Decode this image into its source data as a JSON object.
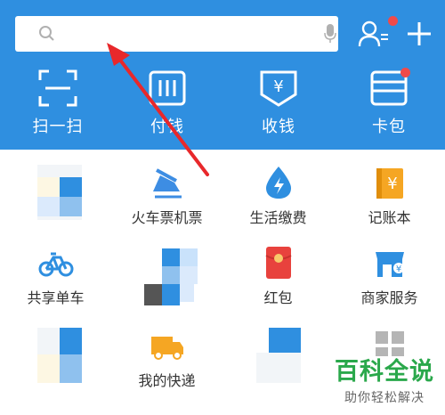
{
  "colors": {
    "brand": "#2f8fe0",
    "badge": "#f04a4a",
    "arrow": "#e8282b",
    "watermark": "#2aa84b"
  },
  "header": {
    "search": {
      "placeholder": "",
      "value": ""
    },
    "icons": [
      "contacts-icon",
      "add-icon"
    ]
  },
  "quick_actions": [
    {
      "label": "扫一扫",
      "icon": "scan-icon"
    },
    {
      "label": "付钱",
      "icon": "pay-icon"
    },
    {
      "label": "收钱",
      "icon": "receive-icon"
    },
    {
      "label": "卡包",
      "icon": "card-pack-icon"
    }
  ],
  "grid": [
    {
      "label": "",
      "icon": "blurred-app-icon"
    },
    {
      "label": "火车票机票",
      "icon": "train-ticket-icon"
    },
    {
      "label": "生活缴费",
      "icon": "utility-bill-icon"
    },
    {
      "label": "记账本",
      "icon": "ledger-icon"
    },
    {
      "label": "共享单车",
      "icon": "bike-icon"
    },
    {
      "label": "",
      "icon": "blurred-app-icon"
    },
    {
      "label": "红包",
      "icon": "red-packet-icon"
    },
    {
      "label": "商家服务",
      "icon": "merchant-icon"
    },
    {
      "label": "",
      "icon": "blurred-app-icon"
    },
    {
      "label": "我的快递",
      "icon": "delivery-icon"
    },
    {
      "label": "",
      "icon": "blurred-app-icon"
    },
    {
      "label": "",
      "icon": "more-apps-icon"
    }
  ],
  "watermark": {
    "title": "百科全说",
    "subtitle": "助你轻松解决"
  }
}
